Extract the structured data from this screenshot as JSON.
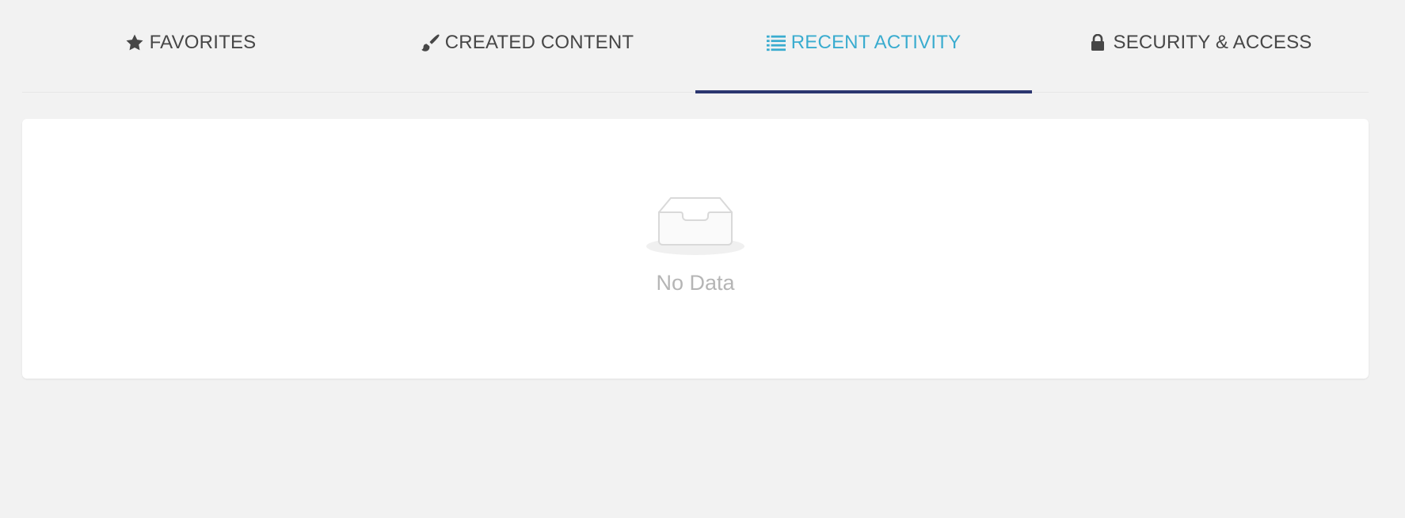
{
  "tabs": [
    {
      "label": "FAVORITES",
      "icon": "star-icon",
      "active": false
    },
    {
      "label": "CREATED CONTENT",
      "icon": "paintbrush-icon",
      "active": false
    },
    {
      "label": "RECENT ACTIVITY",
      "icon": "list-icon",
      "active": true
    },
    {
      "label": "SECURITY & ACCESS",
      "icon": "lock-icon",
      "active": false
    }
  ],
  "empty_state": {
    "icon": "empty-inbox-icon",
    "text": "No Data"
  },
  "colors": {
    "background": "#f2f2f2",
    "tab_text": "#474747",
    "active_tab_text": "#3aaccf",
    "active_tab_underline": "#2c3670",
    "empty_text": "#b5b5b5",
    "card_background": "#ffffff"
  }
}
